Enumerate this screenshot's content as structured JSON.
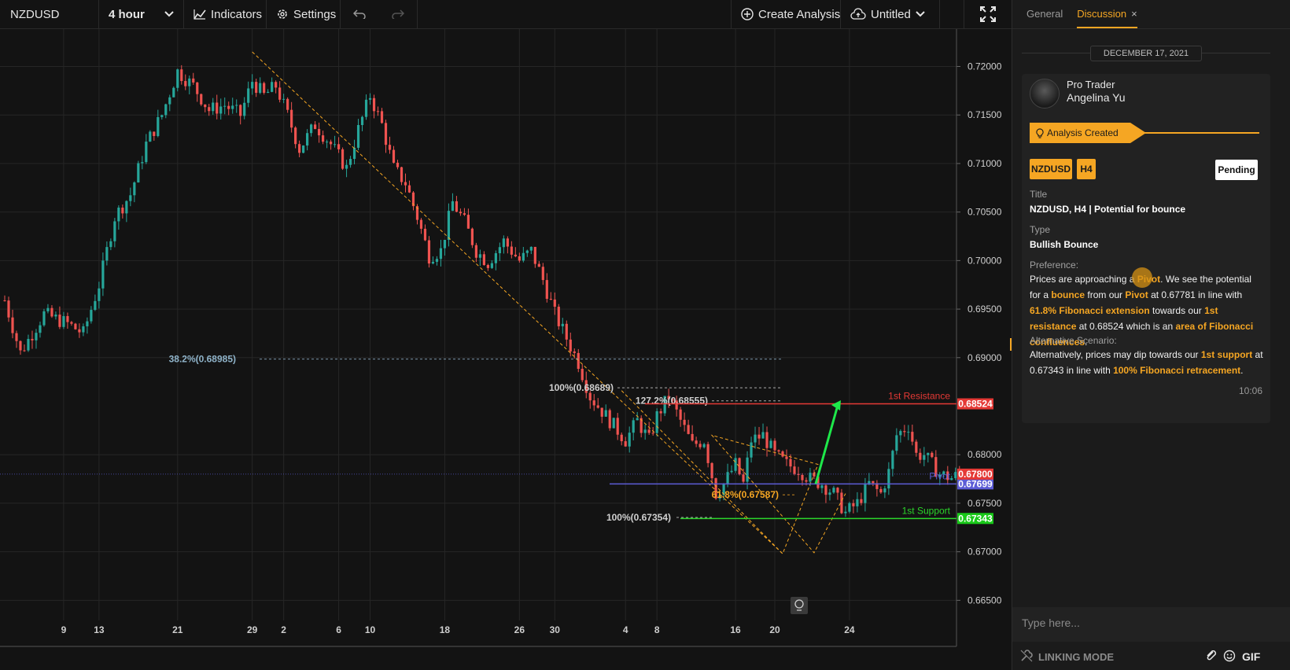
{
  "toolbar": {
    "symbol": "NZDUSD",
    "timeframe": "4 hour",
    "indicators_label": "Indicators",
    "settings_label": "Settings",
    "create_analysis_label": "Create Analysis",
    "layout_label": "Untitled"
  },
  "colors": {
    "accent": "#f5a623",
    "bull": "#26a69a",
    "bear": "#ef5350",
    "resistance": "#e53935",
    "pivot": "#5c5cd6",
    "support": "#2bd62b",
    "arrow": "#1ee84a"
  },
  "chart_data": {
    "type": "candlestick",
    "symbol": "NZDUSD",
    "timeframe": "H4",
    "y_ticks": [
      "0.72000",
      "0.71500",
      "0.71000",
      "0.70500",
      "0.70000",
      "0.69500",
      "0.69000",
      "0.68000",
      "0.67500",
      "0.67000",
      "0.66500"
    ],
    "ylim": [
      0.6635,
      0.7231
    ],
    "x_ticks": [
      "9",
      "13",
      "21",
      "29",
      "2",
      "6",
      "10",
      "18",
      "26",
      "30",
      "4",
      "8",
      "16",
      "20",
      "24"
    ],
    "x_tick_index": [
      15,
      24,
      44,
      63,
      71,
      85,
      93,
      112,
      131,
      140,
      158,
      166,
      186,
      196,
      215
    ],
    "last_price": "0.67800",
    "price_path": [
      [
        0,
        0.6959
      ],
      [
        4,
        0.6905
      ],
      [
        10,
        0.6945
      ],
      [
        16,
        0.6935
      ],
      [
        20,
        0.6925
      ],
      [
        24,
        0.6975
      ],
      [
        28,
        0.7045
      ],
      [
        32,
        0.7068
      ],
      [
        36,
        0.712
      ],
      [
        40,
        0.715
      ],
      [
        44,
        0.7195
      ],
      [
        48,
        0.718
      ],
      [
        52,
        0.7155
      ],
      [
        56,
        0.716
      ],
      [
        60,
        0.715
      ],
      [
        63,
        0.7185
      ],
      [
        66,
        0.717
      ],
      [
        69,
        0.718
      ],
      [
        72,
        0.715
      ],
      [
        75,
        0.7115
      ],
      [
        79,
        0.714
      ],
      [
        83,
        0.712
      ],
      [
        87,
        0.7095
      ],
      [
        90,
        0.7135
      ],
      [
        93,
        0.717
      ],
      [
        96,
        0.714
      ],
      [
        99,
        0.7095
      ],
      [
        102,
        0.708
      ],
      [
        105,
        0.7045
      ],
      [
        108,
        0.7005
      ],
      [
        111,
        0.701
      ],
      [
        114,
        0.706
      ],
      [
        117,
        0.704
      ],
      [
        120,
        0.701
      ],
      [
        123,
        0.6998
      ],
      [
        127,
        0.702
      ],
      [
        131,
        0.7
      ],
      [
        134,
        0.701
      ],
      [
        137,
        0.698
      ],
      [
        140,
        0.6945
      ],
      [
        143,
        0.692
      ],
      [
        146,
        0.6895
      ],
      [
        149,
        0.686
      ],
      [
        152,
        0.6845
      ],
      [
        155,
        0.683
      ],
      [
        158,
        0.6815
      ],
      [
        161,
        0.6835
      ],
      [
        164,
        0.6815
      ],
      [
        166,
        0.684
      ],
      [
        169,
        0.686
      ],
      [
        172,
        0.6835
      ],
      [
        175,
        0.681
      ],
      [
        178,
        0.6815
      ],
      [
        181,
        0.676
      ],
      [
        183,
        0.677
      ],
      [
        186,
        0.679
      ],
      [
        188,
        0.677
      ],
      [
        190,
        0.6815
      ],
      [
        193,
        0.682
      ],
      [
        196,
        0.68
      ],
      [
        199,
        0.679
      ],
      [
        202,
        0.6785
      ],
      [
        205,
        0.6775
      ],
      [
        208,
        0.677
      ],
      [
        211,
        0.676
      ],
      [
        214,
        0.674
      ],
      [
        217,
        0.675
      ],
      [
        220,
        0.677
      ],
      [
        223,
        0.676
      ],
      [
        225,
        0.6782
      ],
      [
        227,
        0.682
      ],
      [
        230,
        0.683
      ],
      [
        232,
        0.68
      ],
      [
        234,
        0.68
      ],
      [
        236,
        0.679
      ],
      [
        238,
        0.678
      ],
      [
        241,
        0.6776
      ],
      [
        243,
        0.678
      ]
    ],
    "levels": [
      {
        "name": "1st Resistance",
        "value": 0.68524,
        "label": "0.68524"
      },
      {
        "name": "Pivot",
        "value": 0.67699,
        "label": "0.67699"
      },
      {
        "name": "1st Support",
        "value": 0.67343,
        "label": "0.67343"
      }
    ],
    "fib_labels": [
      {
        "text": "38.2%(0.68985)",
        "value": 0.68985
      },
      {
        "text": "100%(0.68689)",
        "value": 0.68689
      },
      {
        "text": "127.2%(0.68555)",
        "value": 0.68555
      },
      {
        "text": "61.8%(0.67587)",
        "value": 0.67587
      },
      {
        "text": "100%(0.67354)",
        "value": 0.67354
      }
    ]
  },
  "panel": {
    "tabs": [
      "General",
      "Discussion"
    ],
    "date": "DECEMBER 17, 2021",
    "author_role": "Pro Trader",
    "author_name": "Angelina Yu",
    "status": "Analysis Created",
    "tags": [
      "NZDUSD",
      "H4"
    ],
    "pending_label": "Pending",
    "title_label": "Title",
    "title_value": "NZDUSD, H4 | Potential for bounce",
    "type_label": "Type",
    "type_value": "Bullish Bounce",
    "preference_label": "Preference:",
    "preference": {
      "t1": "Prices are approaching a ",
      "h1": "Pivot",
      "t2": ". We see the potential for a ",
      "h2": "bounce",
      "t3": " from our ",
      "h3": "Pivot",
      "t4": " at 0.67781 in line with ",
      "h4": "61.8% Fibonacci extension",
      "t5": " towards our ",
      "h5": "1st resistance",
      "t6": " at 0.68524 which is an ",
      "h6": "area of Fibonacci confluences",
      "t7": "."
    },
    "alt_label": "Alternative Scenario:",
    "alternative": {
      "t1": "Alternatively, prices may dip towards our ",
      "h1": "1st support",
      "t2": " at 0.67343 in line with ",
      "h2": "100% Fibonacci retracement",
      "t3": "."
    },
    "time": "10:06",
    "composer_placeholder": "Type here...",
    "linking_mode_label": "LINKING MODE",
    "gif_label": "GIF"
  }
}
